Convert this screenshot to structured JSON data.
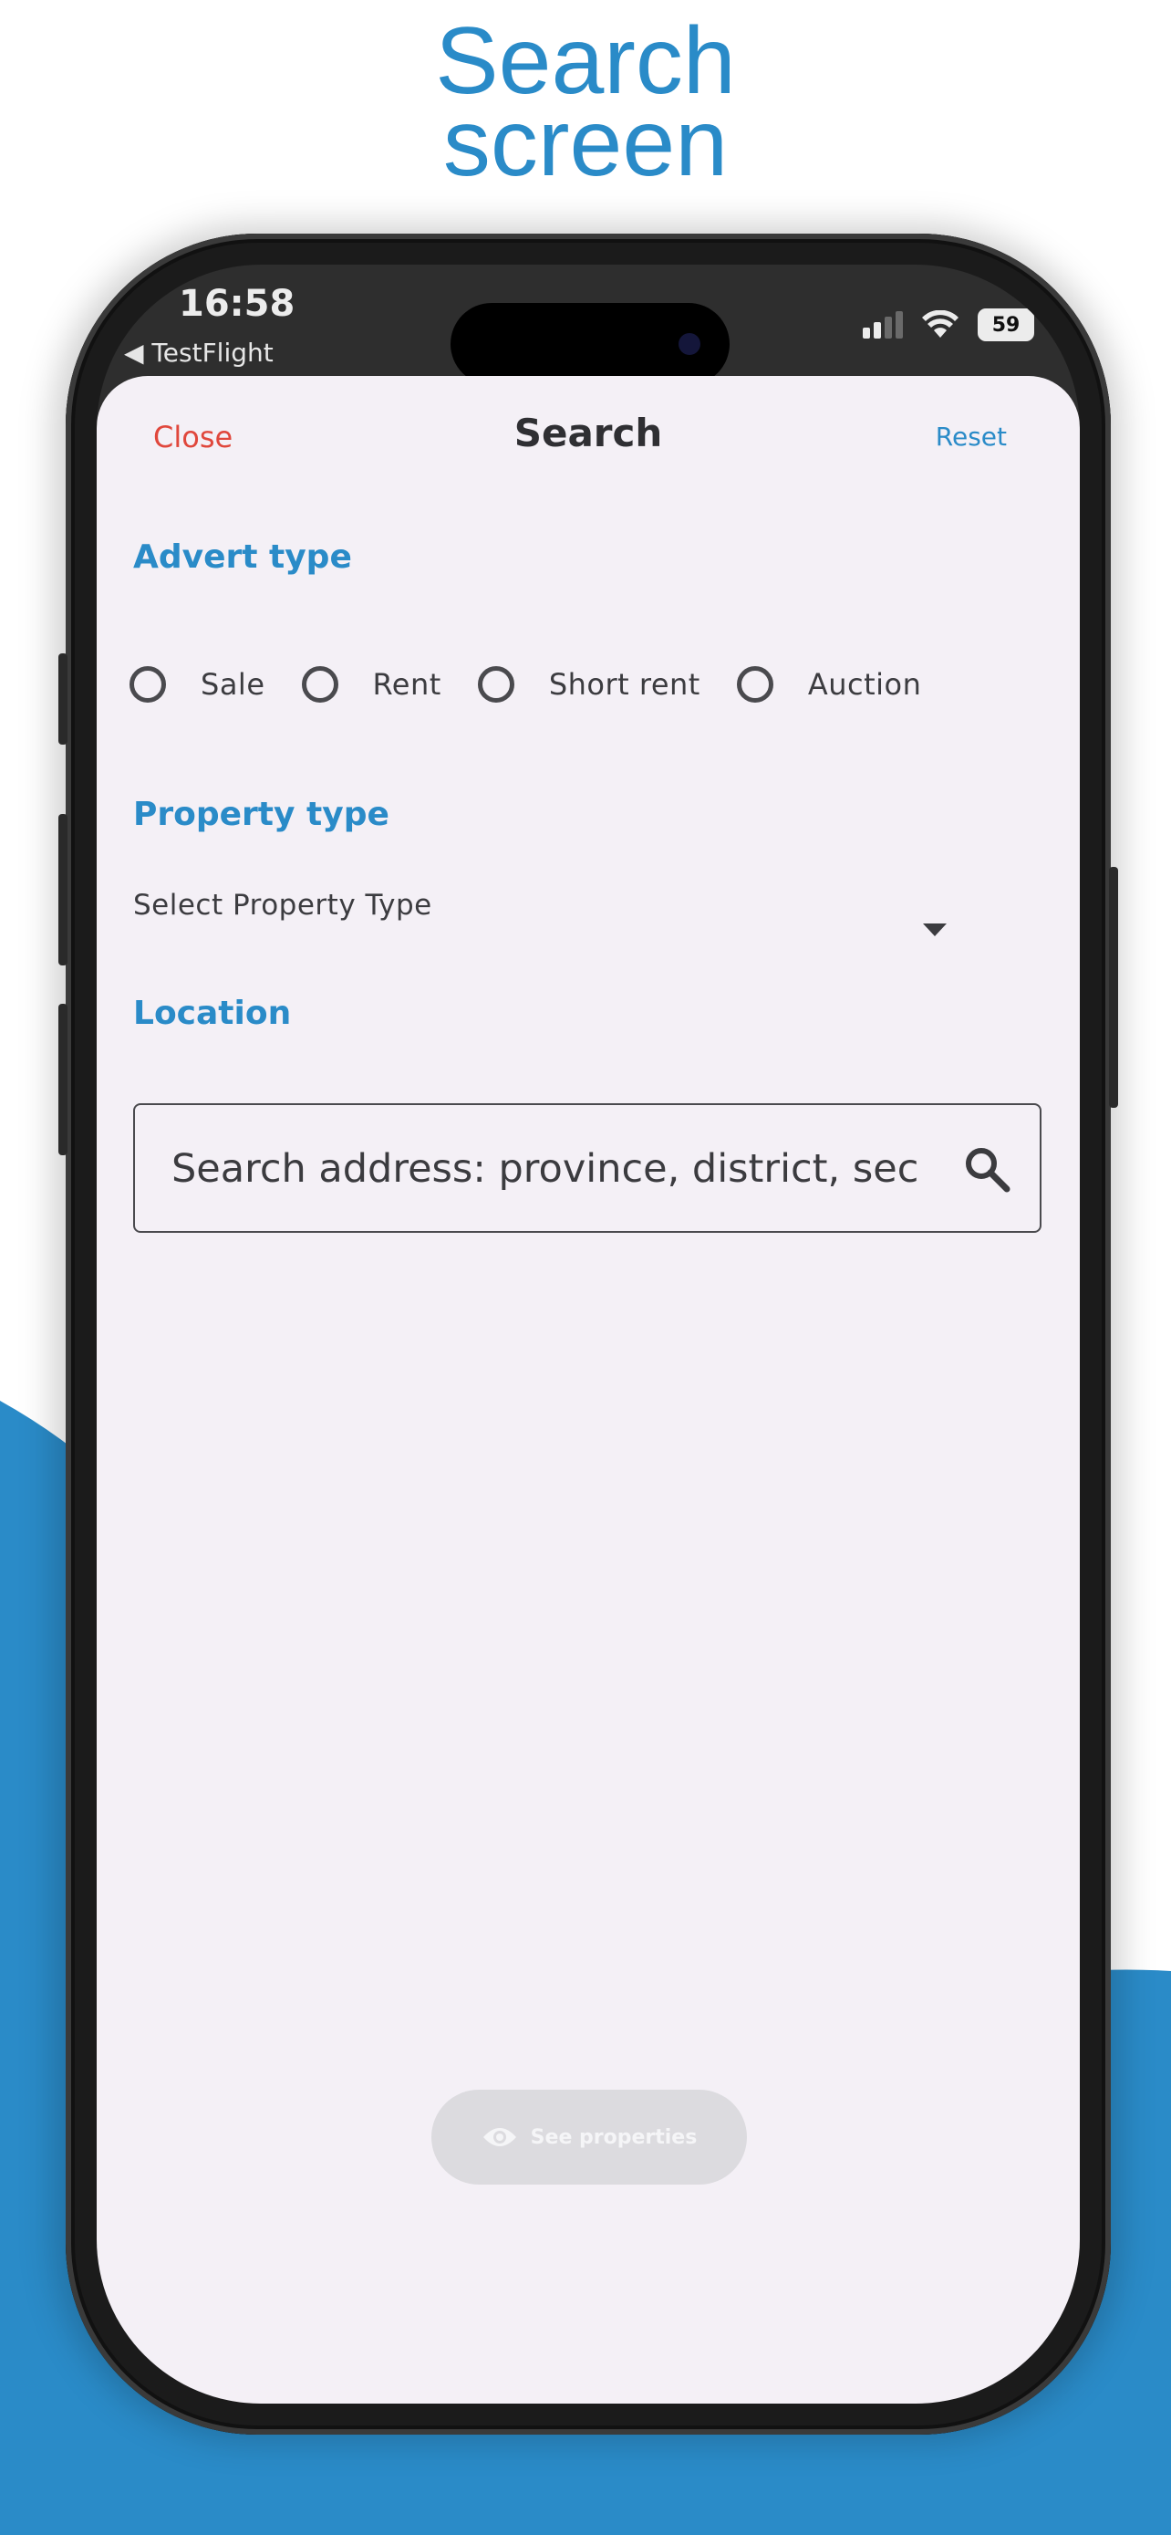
{
  "promo": {
    "headline_line1": "Search",
    "headline_line2": "screen",
    "accent_color": "#2a8bc8"
  },
  "status_bar": {
    "time": "16:58",
    "back_app": "◀ TestFlight",
    "battery": "59",
    "icons": [
      "cellular-signal-icon",
      "wifi-icon",
      "battery-icon"
    ]
  },
  "topbar": {
    "close_label": "Close",
    "title": "Search",
    "reset_label": "Reset"
  },
  "advert_type": {
    "title": "Advert type",
    "options": [
      "Sale",
      "Rent",
      "Short rent",
      "Auction"
    ],
    "selected": null
  },
  "property_type": {
    "title": "Property type",
    "placeholder": "Select Property Type"
  },
  "location": {
    "title": "Location",
    "search_placeholder": "Search address: province, district, sec…"
  },
  "footer": {
    "see_properties_label": "See properties"
  }
}
